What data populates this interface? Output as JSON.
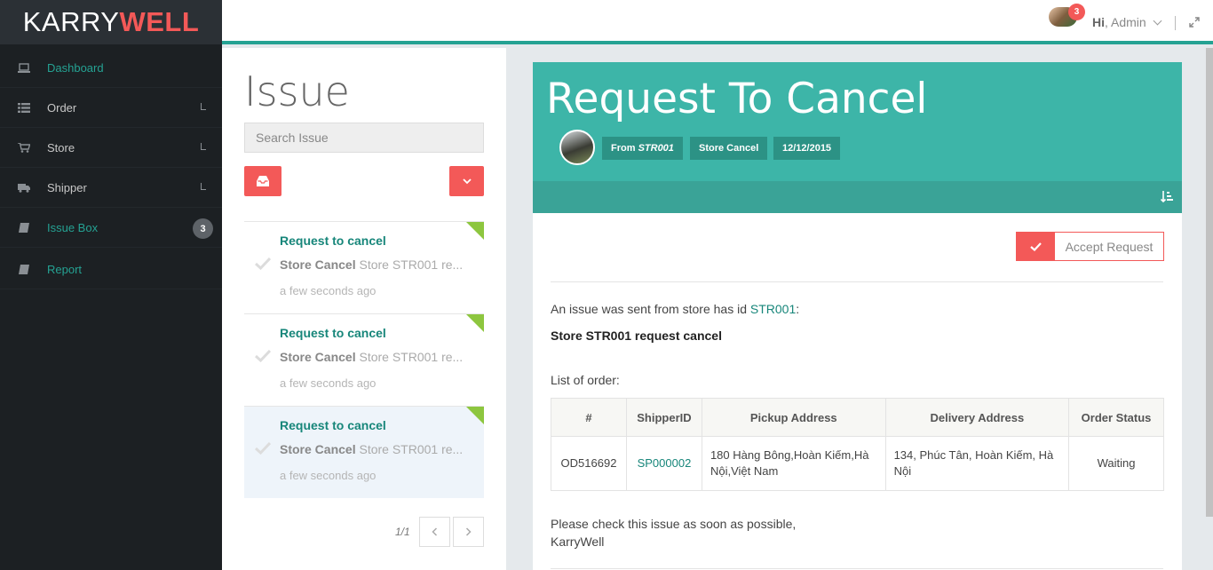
{
  "brand": {
    "part1": "KARRY",
    "part2": "WELL"
  },
  "sidebar": {
    "items": [
      {
        "label": "Dashboard",
        "icon": "laptop-icon",
        "active": true
      },
      {
        "label": "Order",
        "icon": "list-icon"
      },
      {
        "label": "Store",
        "icon": "cart-icon"
      },
      {
        "label": "Shipper",
        "icon": "truck-icon"
      },
      {
        "label": "Issue Box",
        "icon": "book-icon",
        "badge": "3"
      },
      {
        "label": "Report",
        "icon": "book-icon"
      }
    ]
  },
  "header": {
    "notifications": "3",
    "hi": "Hi",
    "user": ", Admin"
  },
  "list": {
    "title": "Issue",
    "search_placeholder": "Search Issue",
    "items": [
      {
        "title": "Request to cancel",
        "type": "Store Cancel",
        "preview": " Store STR001 re...",
        "time": "a few seconds ago"
      },
      {
        "title": "Request to cancel",
        "type": "Store Cancel",
        "preview": " Store STR001 re...",
        "time": "a few seconds ago"
      },
      {
        "title": "Request to cancel",
        "type": "Store Cancel",
        "preview": " Store STR001 re...",
        "time": "a few seconds ago"
      }
    ],
    "pager": "1/1"
  },
  "detail": {
    "title": "Request To Cancel",
    "tag_from_prefix": "From ",
    "tag_from_id": "STR001",
    "tag_type": "Store Cancel",
    "tag_date": "12/12/2015",
    "accept_label": "Accept Request",
    "intro_text": "An issue was sent from store has id ",
    "intro_link": "STR001",
    "intro_suffix": ":",
    "headline": "Store STR001 request cancel",
    "list_label": "List of order:",
    "table": {
      "headers": [
        "#",
        "ShipperID",
        "Pickup Address",
        "Delivery Address",
        "Order Status"
      ],
      "rows": [
        [
          "OD516692",
          "SP000002",
          "180 Hàng Bông,Hoàn Kiếm,Hà Nội,Việt Nam",
          "134, Phúc Tân, Hoàn Kiếm, Hà Nội",
          "Waiting"
        ]
      ]
    },
    "closing_1": "Please check this issue as soon as possible,",
    "closing_2": "KarryWell"
  },
  "colors": {
    "accent": "#25a293",
    "header": "#3db5a8",
    "danger": "#f35958",
    "sidebar": "#1c2023"
  }
}
